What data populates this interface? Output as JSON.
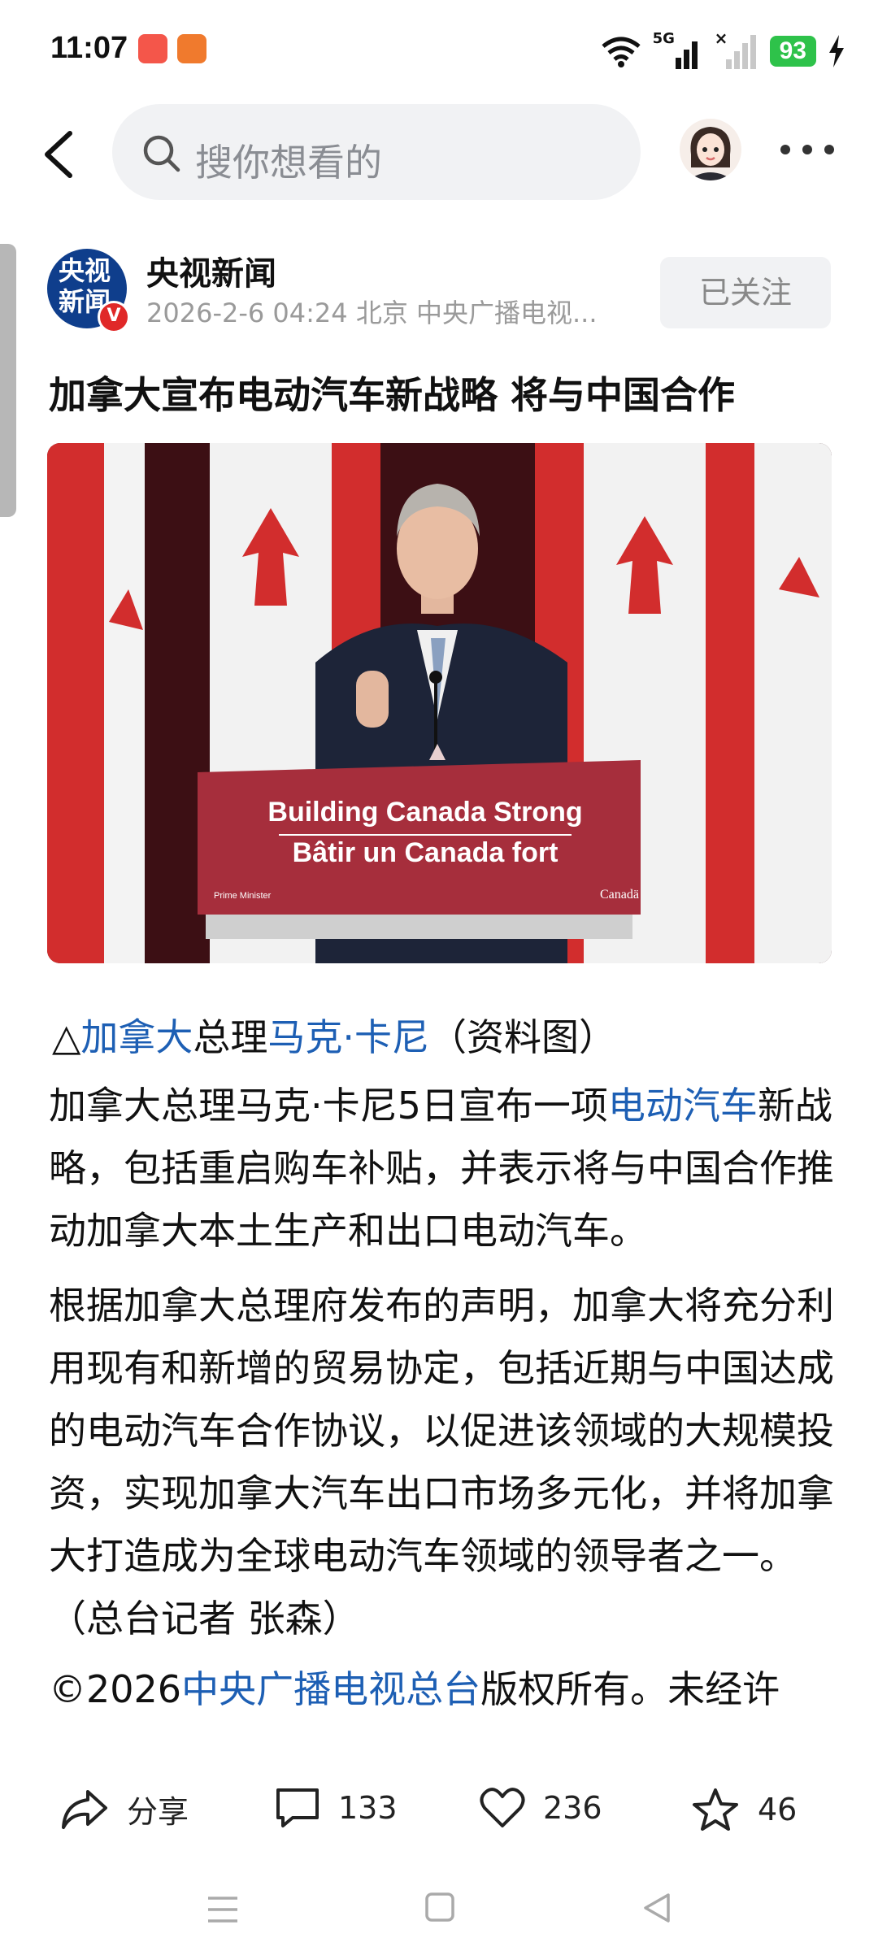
{
  "status_bar": {
    "time": "11:07",
    "network": "5G",
    "battery": "93"
  },
  "search": {
    "placeholder": "搜你想看的"
  },
  "author": {
    "logo_line1": "央视",
    "logo_line2": "新闻",
    "verified_badge": "V",
    "name": "央视新闻",
    "meta": "2026-2-6  04:24  北京  中央广播电视...",
    "follow_label": "已关注"
  },
  "article": {
    "headline": "加拿大宣布电动汽车新战略 将与中国合作",
    "photo": {
      "sign_line1": "Building Canada Strong",
      "sign_line2": "Bâtir un Canada fort",
      "sign_small_left": "Prime Minister",
      "sign_small_right": "Canadä"
    },
    "caption": {
      "prefix": "△",
      "link1": "加拿大",
      "middle": "总理",
      "link2": "马克·卡尼",
      "suffix": "（资料图）"
    },
    "para1": {
      "a": "加拿大总理马克·卡尼5日宣布一项",
      "link": "电动汽车",
      "b": "新战略，包括重启购车补贴，并表示将与中国合作推动加拿大本土生产和出口电动汽车。"
    },
    "para2": "根据加拿大总理府发布的声明，加拿大将充分利用现有和新增的贸易协定，包括近期与中国达成的电动汽车合作协议，以促进该领域的大规模投资，实现加拿大汽车出口市场多元化，并将加拿大打造成为全球电动汽车领域的领导者之一。（总台记者 张森）",
    "copyright": {
      "a": "©2026",
      "link": "中央广播电视总台",
      "b": "版权所有。未经许"
    }
  },
  "actions": {
    "share_label": "分享",
    "comments_count": "133",
    "likes_count": "236",
    "favorites_count": "46"
  },
  "colors": {
    "link": "#1d5fb4",
    "battery": "#2ec24a",
    "logo_bg": "#0f3e8c"
  }
}
